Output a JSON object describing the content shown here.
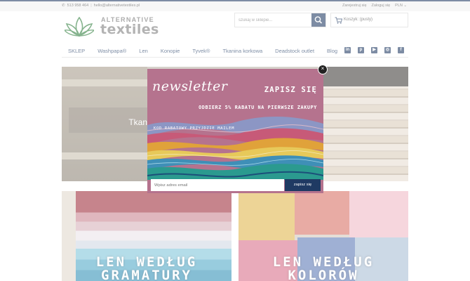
{
  "topbar": {
    "phone": "513 958 464",
    "email": "hello@alternativetextiles.pl",
    "register": "Zarejestruj się",
    "login": "Zaloguj się",
    "currency": "PLN"
  },
  "brand": {
    "line1": "ALTERNATIVE",
    "line2": "textiles"
  },
  "search": {
    "placeholder": "szukaj w sklepie..."
  },
  "cart": {
    "label": "Koszyk: (pusty)"
  },
  "nav": {
    "items": [
      "SKLEP",
      "Washpapa®",
      "Len",
      "Konopie",
      "Tyvek®",
      "Tkanina korkowa",
      "Deadstock outlet",
      "Blog"
    ]
  },
  "social": [
    "linkedin-icon",
    "pinterest-icon",
    "youtube-icon",
    "instagram-icon",
    "facebook-icon"
  ],
  "hero": {
    "partial_text": "Tkan"
  },
  "tiles": [
    {
      "title_line1": "LEN WEDŁUG",
      "title_line2": "GRAMATURY"
    },
    {
      "title_line1": "LEN WEDŁUG",
      "title_line2": "KOLORÓW"
    }
  ],
  "popup": {
    "heading": "newsletter",
    "cta": "ZAPISZ SIĘ",
    "offer": "ODBIERZ 5% RABATU NA PIERWSZE ZAKUPY",
    "code_note": "KOD RABATOWY PRZYJDZIE MAILEM",
    "email_placeholder": "Wpisz adres email",
    "submit": "zapisz się",
    "close": "×"
  },
  "colors": {
    "primary": "#1f3a63",
    "popup_bg": "#b5738e"
  }
}
